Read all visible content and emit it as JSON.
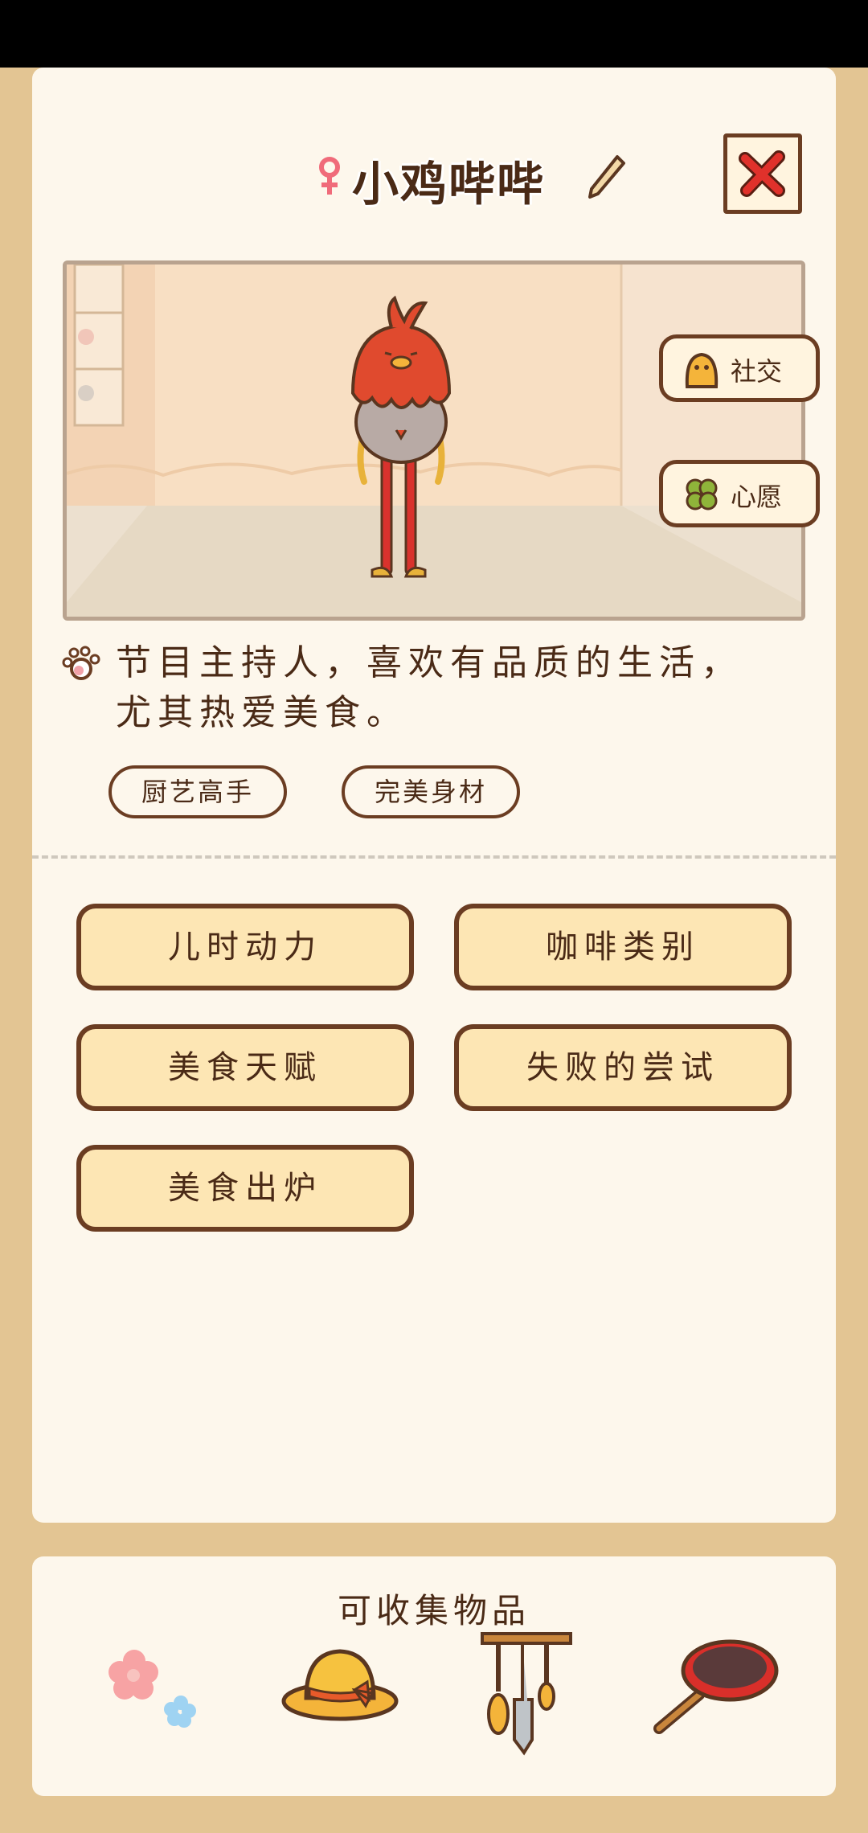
{
  "character": {
    "name": "小鸡哔哔",
    "gender": "female"
  },
  "side_buttons": {
    "social_label": "社交",
    "wish_label": "心愿"
  },
  "description": {
    "line1": "节目主持人，喜欢有品质的生活，",
    "line2": "尤其热爱美食。"
  },
  "tags": [
    "厨艺高手",
    "完美身材"
  ],
  "topics": [
    "儿时动力",
    "咖啡类别",
    "美食天赋",
    "失败的尝试",
    "美食出炉"
  ],
  "collectibles": {
    "title": "可收集物品",
    "items": [
      "flowers-icon",
      "straw-hat-icon",
      "utensil-rack-icon",
      "frying-pan-icon"
    ]
  },
  "colors": {
    "background": "#e3c593",
    "card": "#fdf7ec",
    "button_fill": "#fde6b4",
    "border": "#6b3d22",
    "close_x": "#e0312b"
  }
}
